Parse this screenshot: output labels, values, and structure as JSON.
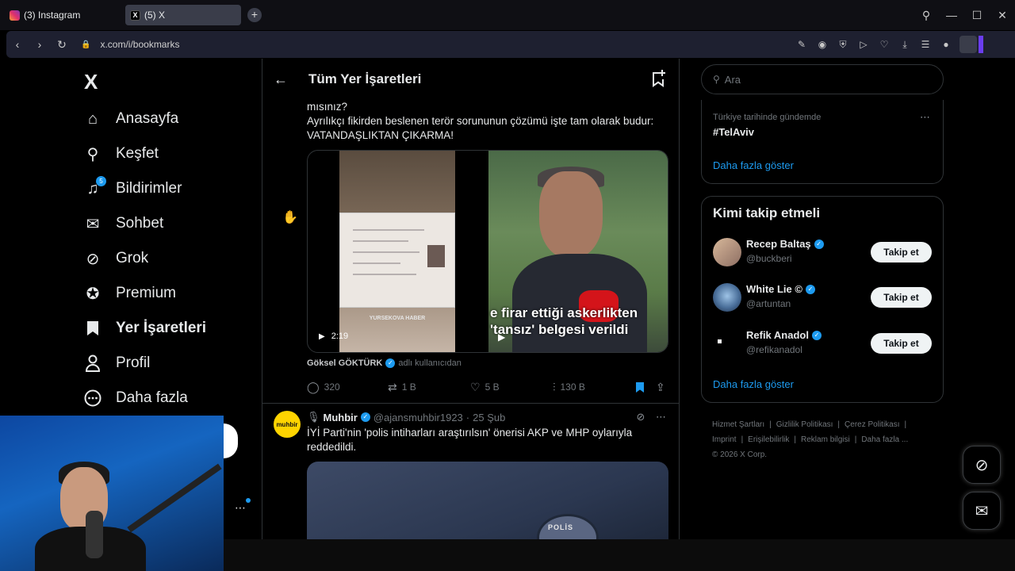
{
  "browser": {
    "tabs": [
      {
        "label": "(3) Instagram",
        "icon": "instagram-icon"
      },
      {
        "label": "(5) X",
        "icon": "x-icon"
      }
    ],
    "url": "x.com/i/bookmarks"
  },
  "sidebar": {
    "logo": "X",
    "items": [
      {
        "label": "Anasayfa",
        "icon": "home-icon",
        "glyph": "⌂"
      },
      {
        "label": "Keşfet",
        "icon": "search-icon",
        "glyph": "⚲"
      },
      {
        "label": "Bildirimler",
        "icon": "bell-icon",
        "glyph": "🔔",
        "badge": "5"
      },
      {
        "label": "Sohbet",
        "icon": "mail-icon",
        "glyph": "✉"
      },
      {
        "label": "Grok",
        "icon": "grok-icon",
        "glyph": "⊘"
      },
      {
        "label": "Premium",
        "icon": "verified-icon",
        "glyph": "✪"
      },
      {
        "label": "Yer İşaretleri",
        "icon": "bookmark-icon",
        "glyph": "🔖",
        "active": true
      },
      {
        "label": "Profil",
        "icon": "person-icon",
        "glyph": "👤"
      },
      {
        "label": "Daha fazla",
        "icon": "more-circle-icon",
        "glyph": "⋯"
      }
    ]
  },
  "main": {
    "title": "Tüm Yer İşaretleri",
    "tweet1": {
      "text_line1": "mısınız?",
      "text_line2": "Ayrılıkçı fikirden beslenen terör sorununun çözümü işte tam olarak budur:",
      "text_line3": "VATANDAŞLIKTAN ÇIKARMA!",
      "media": {
        "caption_left": "YURSEKOVA HABER",
        "subtitle": "e firar ettiği askerlikten 'tansız' belgesi verildi",
        "duration": "2:19"
      },
      "source_name": "Göksel GÖKTÜRK",
      "source_suffix": "adlı kullanıcıdan",
      "replies": "320",
      "reposts": "1 B",
      "likes": "5 B",
      "views": "130 B"
    },
    "tweet2": {
      "avatar_text": "muhbir",
      "name": "Muhbir",
      "handle": "@ajansmuhbir1923",
      "date": "25 Şub",
      "text": "İYİ Parti'nin 'polis intiharları araştırılsın' önerisi AKP ve MHP oylarıyla reddedildi.",
      "media_text": "POLİS"
    }
  },
  "right": {
    "search_placeholder": "Ara",
    "trend": {
      "context": "Türkiye tarihinde gündemde",
      "tag": "#TelAviv",
      "show_more": "Daha fazla göster"
    },
    "who_to_follow": {
      "title": "Kimi takip etmeli",
      "accounts": [
        {
          "name": "Recep Baltaş",
          "handle": "@buckberi",
          "button": "Takip et"
        },
        {
          "name": "White Lie ©",
          "handle": "@artuntan",
          "button": "Takip et"
        },
        {
          "name": "Refik Anadol",
          "handle": "@refikanadol",
          "button": "Takip et"
        }
      ],
      "show_more": "Daha fazla göster"
    },
    "footer": {
      "links": [
        "Hizmet Şartları",
        "Gizlilik Politikası",
        "Çerez Politikası",
        "Imprint",
        "Erişilebilirlik",
        "Reklam bilgisi",
        "Daha fazla ..."
      ],
      "copyright": "© 2026 X Corp."
    }
  },
  "colors": {
    "accent": "#1d9bf0",
    "background": "#000000",
    "border": "#2f3336"
  }
}
